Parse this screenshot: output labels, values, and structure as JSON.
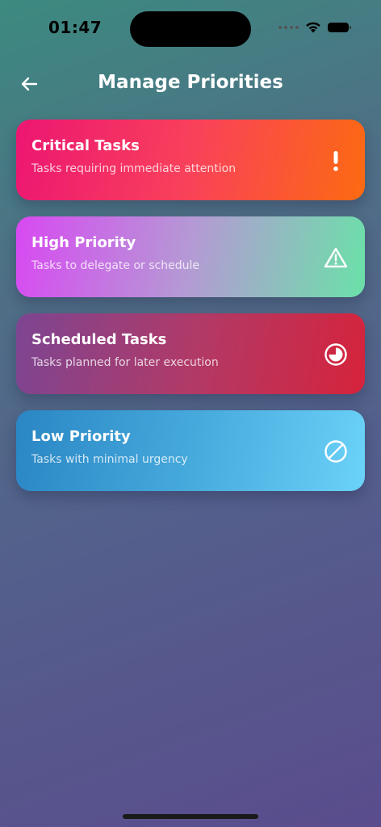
{
  "status_bar": {
    "time": "01:47"
  },
  "header": {
    "title": "Manage Priorities",
    "back_icon": "arrow-left-icon"
  },
  "cards": [
    {
      "title": "Critical Tasks",
      "subtitle": "Tasks requiring immediate attention",
      "icon": "exclamation-icon",
      "colors": [
        "#ec1672",
        "#fc6a11"
      ]
    },
    {
      "title": "High Priority",
      "subtitle": "Tasks to delegate or schedule",
      "icon": "warning-triangle-icon",
      "colors": [
        "#d849f2",
        "#6ae1a8"
      ]
    },
    {
      "title": "Scheduled Tasks",
      "subtitle": "Tasks planned for later execution",
      "icon": "clock-icon",
      "colors": [
        "#7d4592",
        "#d6233b"
      ]
    },
    {
      "title": "Low Priority",
      "subtitle": "Tasks with minimal urgency",
      "icon": "block-icon",
      "colors": [
        "#2a86c4",
        "#6bd2f8"
      ]
    }
  ]
}
